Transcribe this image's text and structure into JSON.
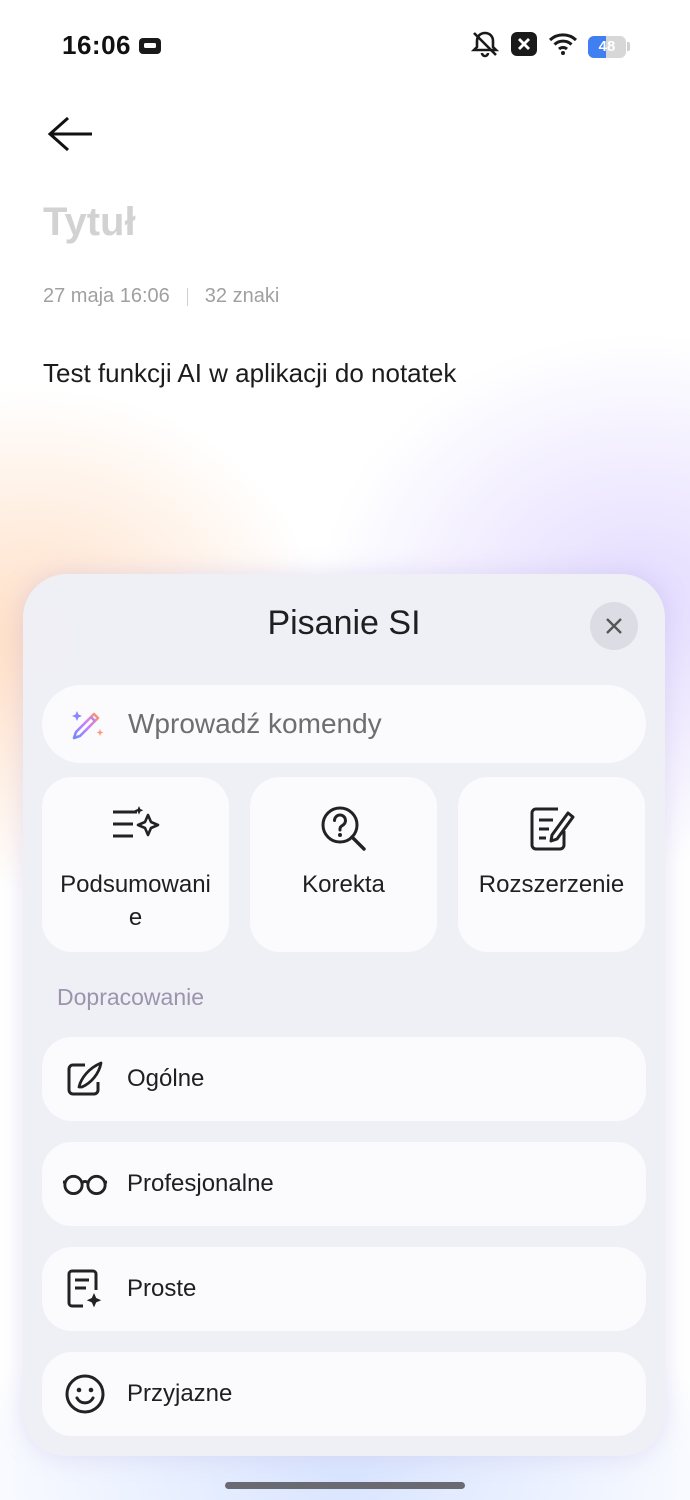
{
  "status_bar": {
    "time": "16:06",
    "battery_level": "48",
    "battery_fraction": 0.48,
    "icons": [
      "sim-card-icon",
      "silent-bell-icon",
      "notification-x-icon",
      "wifi-icon",
      "battery-icon"
    ]
  },
  "note": {
    "title_placeholder": "Tytuł",
    "date": "27 maja 16:06",
    "char_count": "32 znaki",
    "body": "Test funkcji AI w aplikacji do notatek"
  },
  "sheet": {
    "title": "Pisanie SI",
    "command_placeholder": "Wprowadź komendy",
    "actions": [
      {
        "label": "Podsumowanie",
        "icon": "summary-sparkle-icon"
      },
      {
        "label": "Korekta",
        "icon": "proofread-search-icon"
      },
      {
        "label": "Rozszerzenie",
        "icon": "expand-edit-icon"
      }
    ],
    "section_label": "Dopracowanie",
    "options": [
      {
        "label": "Ogólne",
        "icon": "pen-note-icon"
      },
      {
        "label": "Profesjonalne",
        "icon": "glasses-icon"
      },
      {
        "label": "Proste",
        "icon": "simple-doc-icon"
      },
      {
        "label": "Przyjazne",
        "icon": "smile-icon"
      }
    ]
  },
  "colors": {
    "accent_blue": "#3f7ff2",
    "section_label": "#9d93ad",
    "title_placeholder": "#d2d2d2"
  }
}
